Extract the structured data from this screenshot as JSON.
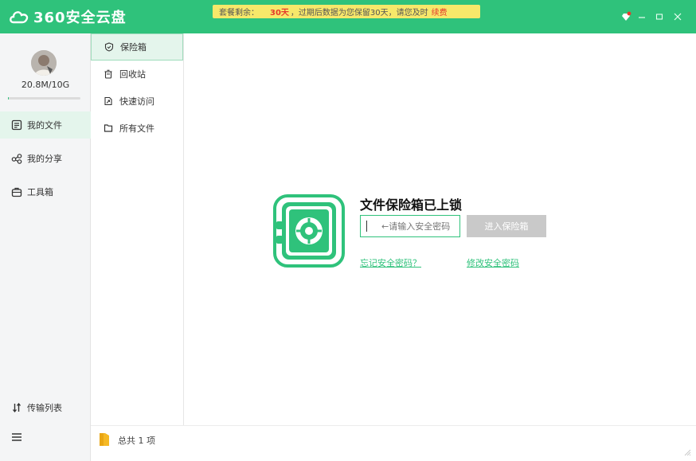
{
  "app": {
    "title": "360安全云盘",
    "accent_color": "#2fc27b"
  },
  "notice": {
    "prefix": "套餐剩余：",
    "days": "30天",
    "message": "，过期后数据为您保留30天，请您及时",
    "renew": "续费"
  },
  "window_controls": [
    "skin-icon",
    "minimize-icon",
    "maximize-icon",
    "close-icon"
  ],
  "user": {
    "storage": "20.8M/10G",
    "storage_used_fraction": 0.002
  },
  "sidebar": {
    "items": [
      {
        "label": "我的文件",
        "icon": "file-list-icon",
        "active": true
      },
      {
        "label": "我的分享",
        "icon": "share-icon",
        "active": false
      },
      {
        "label": "工具箱",
        "icon": "toolbox-icon",
        "active": false
      }
    ],
    "bottom": {
      "transfer_label": "传输列表",
      "transfer_icon": "transfer-icon",
      "menu_icon": "hamburger-menu-icon"
    }
  },
  "subnav": {
    "items": [
      {
        "label": "保险箱",
        "icon": "shield-icon",
        "active": true
      },
      {
        "label": "回收站",
        "icon": "recycle-bin-icon",
        "active": false
      },
      {
        "label": "快速访问",
        "icon": "quick-access-icon",
        "active": false
      },
      {
        "label": "所有文件",
        "icon": "folder-outline-icon",
        "active": false
      }
    ]
  },
  "vault": {
    "title": "文件保险箱已上锁",
    "password_placeholder": "←请输入安全密码",
    "enter_button": "进入保险箱",
    "forgot_link": "忘记安全密码？",
    "change_link": "修改安全密码"
  },
  "status": {
    "total": "总共 1 项"
  }
}
